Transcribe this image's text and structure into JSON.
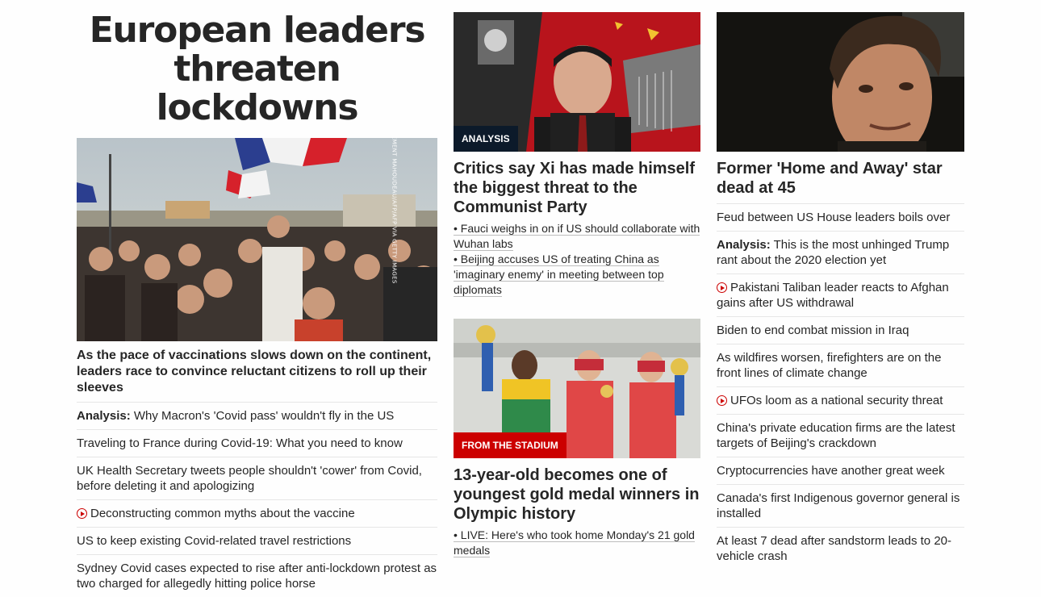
{
  "column1": {
    "headline": "European leaders threaten lockdowns",
    "image": {
      "alt": "Protesters waving French flags",
      "credit": "CLEMENT MAHOUDEAU/AFP/AFP VIA GETTY IMAGES"
    },
    "caption": "As the pace of vaccinations slows down on the continent, leaders race to convince reluctant citizens to roll up their sleeves",
    "items": [
      {
        "prefix": "Analysis:",
        "text": "Why Macron's 'Covid pass' wouldn't fly in the US",
        "video": false
      },
      {
        "prefix": "",
        "text": "Traveling to France during Covid-19: What you need to know",
        "video": false
      },
      {
        "prefix": "",
        "text": "UK Health Secretary tweets people shouldn't 'cower' from Covid, before deleting it and apologizing",
        "video": false
      },
      {
        "prefix": "",
        "text": "Deconstructing common myths about the vaccine",
        "video": true
      },
      {
        "prefix": "",
        "text": "US to keep existing Covid-related travel restrictions",
        "video": false
      },
      {
        "prefix": "",
        "text": "Sydney Covid cases expected to rise after anti-lockdown protest as two charged for allegedly hitting police horse",
        "video": false
      }
    ]
  },
  "column2": {
    "story1": {
      "label": "ANALYSIS",
      "headline": "Critics say Xi has made himself the biggest threat to the Communist Party",
      "sublinks": [
        "• Fauci weighs in on if US should collaborate with Wuhan labs",
        "• Beijing accuses US of treating China as 'imaginary enemy' in meeting between top diplomats"
      ]
    },
    "story2": {
      "label": "FROM THE STADIUM",
      "headline": "13-year-old becomes one of youngest gold medal winners in Olympic history",
      "sublinks": [
        "• LIVE: Here's who took home Monday's 21 gold medals"
      ]
    }
  },
  "column3": {
    "headline": "Former 'Home and Away' star dead at 45",
    "items": [
      {
        "prefix": "",
        "text": "Feud between US House leaders boils over",
        "video": false
      },
      {
        "prefix": "Analysis:",
        "text": "This is the most unhinged Trump rant about the 2020 election yet",
        "video": false
      },
      {
        "prefix": "",
        "text": "Pakistani Taliban leader reacts to Afghan gains after US withdrawal",
        "video": true
      },
      {
        "prefix": "",
        "text": "Biden to end combat mission in Iraq",
        "video": false
      },
      {
        "prefix": "",
        "text": "As wildfires worsen, firefighters are on the front lines of climate change",
        "video": false
      },
      {
        "prefix": "",
        "text": "UFOs loom as a national security threat",
        "video": true
      },
      {
        "prefix": "",
        "text": "China's private education firms are the latest targets of Beijing's crackdown",
        "video": false
      },
      {
        "prefix": "",
        "text": "Cryptocurrencies have another great week",
        "video": false
      },
      {
        "prefix": "",
        "text": "Canada's first Indigenous governor general is installed",
        "video": false
      },
      {
        "prefix": "",
        "text": "At least 7 dead after sandstorm leads to 20-vehicle crash",
        "video": false
      }
    ]
  },
  "colors": {
    "label_dark": "#0c1a2a",
    "label_red": "#cc0000",
    "text": "#262626",
    "divider": "#e6e6e6"
  },
  "icons": {
    "video": "play-circle-icon"
  }
}
